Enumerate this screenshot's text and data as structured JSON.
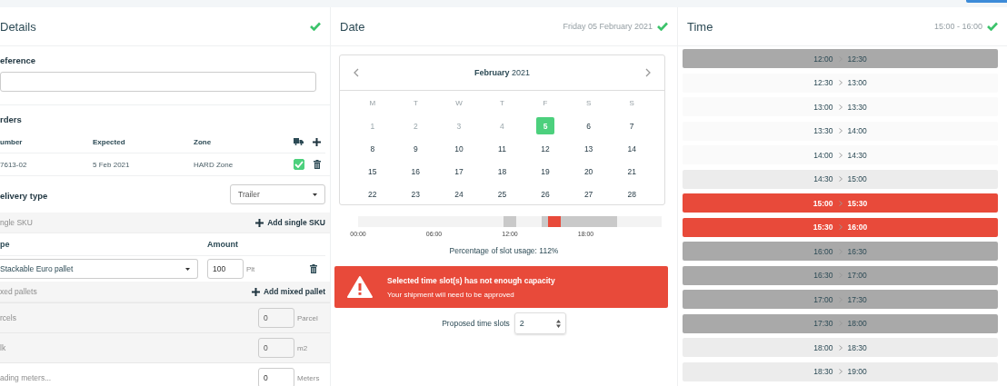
{
  "details": {
    "title": "Details",
    "complete": true,
    "reference": {
      "label": "eference"
    },
    "orders": {
      "title": "rders",
      "columns": [
        "umber",
        "Expected",
        "Zone"
      ],
      "rows": [
        {
          "cells": [
            "7613-02",
            "5 Feb 2021",
            "HARD Zone"
          ],
          "checked": true
        }
      ]
    },
    "delivery_type": {
      "label": "elivery type",
      "value": "Trailer"
    },
    "single_sku": {
      "label": "ngle SKU",
      "action": "Add single SKU",
      "columns": [
        "pe",
        "Amount"
      ],
      "rows": [
        {
          "type": "Stackable Euro pallet",
          "amount": "100",
          "unit": "Plt"
        }
      ]
    },
    "mixed_pallets": {
      "label": "xed pallets",
      "action": "Add mixed pallet"
    },
    "extras": [
      {
        "label": "rcels",
        "value": "0",
        "unit": "Parcel",
        "disabled": true
      },
      {
        "label": "lk",
        "value": "0",
        "unit": "m2",
        "disabled": true
      },
      {
        "label": "ading meters...",
        "value": "0",
        "unit": "Meters",
        "disabled": false
      }
    ]
  },
  "date": {
    "title": "Date",
    "summary": "Friday 05 February 2021",
    "complete": true,
    "calendar": {
      "month": "February",
      "year": "2021",
      "weekdays": [
        "M",
        "T",
        "W",
        "T",
        "F",
        "S",
        "S"
      ],
      "days": [
        {
          "label": "1",
          "muted": true,
          "selected": false
        },
        {
          "label": "2",
          "muted": true,
          "selected": false
        },
        {
          "label": "3",
          "muted": true,
          "selected": false
        },
        {
          "label": "4",
          "muted": true,
          "selected": false
        },
        {
          "label": "5",
          "muted": false,
          "selected": true
        },
        {
          "label": "6",
          "muted": false,
          "selected": false
        },
        {
          "label": "7",
          "muted": false,
          "selected": false
        },
        {
          "label": "8",
          "muted": false,
          "selected": false
        },
        {
          "label": "9",
          "muted": false,
          "selected": false
        },
        {
          "label": "10",
          "muted": false,
          "selected": false
        },
        {
          "label": "11",
          "muted": false,
          "selected": false
        },
        {
          "label": "12",
          "muted": false,
          "selected": false
        },
        {
          "label": "13",
          "muted": false,
          "selected": false
        },
        {
          "label": "14",
          "muted": false,
          "selected": false
        },
        {
          "label": "15",
          "muted": false,
          "selected": false
        },
        {
          "label": "16",
          "muted": false,
          "selected": false
        },
        {
          "label": "17",
          "muted": false,
          "selected": false
        },
        {
          "label": "18",
          "muted": false,
          "selected": false
        },
        {
          "label": "19",
          "muted": false,
          "selected": false
        },
        {
          "label": "20",
          "muted": false,
          "selected": false
        },
        {
          "label": "21",
          "muted": false,
          "selected": false
        },
        {
          "label": "22",
          "muted": false,
          "selected": false
        },
        {
          "label": "23",
          "muted": false,
          "selected": false
        },
        {
          "label": "24",
          "muted": false,
          "selected": false
        },
        {
          "label": "25",
          "muted": false,
          "selected": false
        },
        {
          "label": "26",
          "muted": false,
          "selected": false
        },
        {
          "label": "27",
          "muted": false,
          "selected": false
        },
        {
          "label": "28",
          "muted": false,
          "selected": false
        }
      ]
    },
    "usage": {
      "ticks": [
        "00:00",
        "06:00",
        "12:00",
        "18:00"
      ],
      "segments": [
        {
          "kind": "empty"
        },
        {
          "kind": "empty"
        },
        {
          "kind": "empty"
        },
        {
          "kind": "empty"
        },
        {
          "kind": "empty"
        },
        {
          "kind": "empty"
        },
        {
          "kind": "empty"
        },
        {
          "kind": "empty"
        },
        {
          "kind": "empty"
        },
        {
          "kind": "empty"
        },
        {
          "kind": "empty"
        },
        {
          "kind": "empty"
        },
        {
          "kind": "empty"
        },
        {
          "kind": "empty"
        },
        {
          "kind": "empty"
        },
        {
          "kind": "empty"
        },
        {
          "kind": "empty"
        },
        {
          "kind": "empty"
        },
        {
          "kind": "empty"
        },
        {
          "kind": "empty"
        },
        {
          "kind": "empty"
        },
        {
          "kind": "empty"
        },
        {
          "kind": "empty"
        },
        {
          "kind": "busy"
        },
        {
          "kind": "busy"
        },
        {
          "kind": "empty"
        },
        {
          "kind": "empty"
        },
        {
          "kind": "empty"
        },
        {
          "kind": "empty"
        },
        {
          "kind": "busy"
        },
        {
          "kind": "selected"
        },
        {
          "kind": "selected"
        },
        {
          "kind": "busy"
        },
        {
          "kind": "busy"
        },
        {
          "kind": "busy"
        },
        {
          "kind": "busy"
        },
        {
          "kind": "busy"
        },
        {
          "kind": "busy"
        },
        {
          "kind": "busy"
        },
        {
          "kind": "busy"
        },
        {
          "kind": "busy"
        },
        {
          "kind": "empty"
        },
        {
          "kind": "empty"
        },
        {
          "kind": "empty"
        },
        {
          "kind": "empty"
        },
        {
          "kind": "empty"
        },
        {
          "kind": "empty"
        },
        {
          "kind": "empty"
        }
      ],
      "caption": "Percentage of slot usage: 112%"
    },
    "alert": {
      "title": "Selected time slot(s) has not enough capacity",
      "message": "Your shipment will need to be approved"
    },
    "proposed": {
      "label": "Proposed time slots",
      "value": "2"
    }
  },
  "time": {
    "title": "Time",
    "summary": "15:00 - 16:00",
    "complete": true,
    "slots": [
      {
        "from": "12:00",
        "to": "12:30",
        "selected": false,
        "kind": "full"
      },
      {
        "from": "12:30",
        "to": "13:00",
        "selected": false,
        "kind": "open"
      },
      {
        "from": "13:00",
        "to": "13:30",
        "selected": false,
        "kind": "open"
      },
      {
        "from": "13:30",
        "to": "14:00",
        "selected": false,
        "kind": "open"
      },
      {
        "from": "14:00",
        "to": "14:30",
        "selected": false,
        "kind": "open"
      },
      {
        "from": "14:30",
        "to": "15:00",
        "selected": false,
        "kind": "partial"
      },
      {
        "from": "15:00",
        "to": "15:30",
        "selected": true,
        "kind": "full"
      },
      {
        "from": "15:30",
        "to": "16:00",
        "selected": true,
        "kind": "full"
      },
      {
        "from": "16:00",
        "to": "16:30",
        "selected": false,
        "kind": "full"
      },
      {
        "from": "16:30",
        "to": "17:00",
        "selected": false,
        "kind": "full"
      },
      {
        "from": "17:00",
        "to": "17:30",
        "selected": false,
        "kind": "full"
      },
      {
        "from": "17:30",
        "to": "18:00",
        "selected": false,
        "kind": "full"
      },
      {
        "from": "18:00",
        "to": "18:30",
        "selected": false,
        "kind": "partial"
      },
      {
        "from": "18:30",
        "to": "19:00",
        "selected": false,
        "kind": "partial"
      }
    ]
  }
}
